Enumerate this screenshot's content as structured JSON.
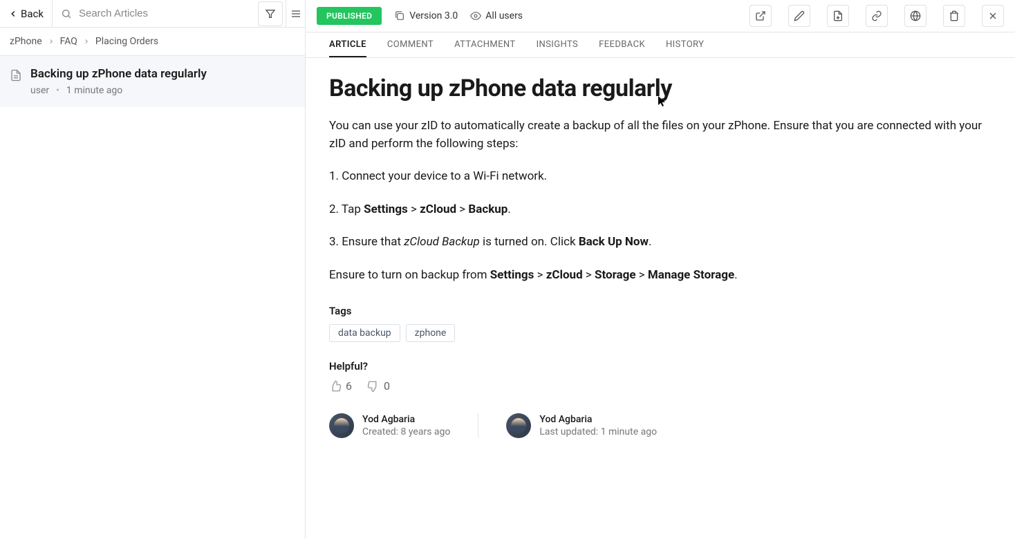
{
  "sidebar": {
    "back": "Back",
    "search_placeholder": "Search Articles"
  },
  "breadcrumb": [
    "zPhone",
    "FAQ",
    "Placing Orders"
  ],
  "list_item": {
    "title": "Backing up zPhone data regularly",
    "author": "user",
    "time": "1 minute ago"
  },
  "header": {
    "status": "PUBLISHED",
    "version": "Version 3.0",
    "visibility": "All users"
  },
  "tabs": [
    "ARTICLE",
    "COMMENT",
    "ATTACHMENT",
    "INSIGHTS",
    "FEEDBACK",
    "HISTORY"
  ],
  "article": {
    "title": "Backing up zPhone data regularly",
    "intro": "You can use your zID to automatically create a backup of all the files on your zPhone. Ensure that you are connected with your zID and perform the following steps:",
    "step1": "1. Connect your device to a Wi-Fi network.",
    "step2_pre": "2. Tap ",
    "step2_b1": "Settings",
    "step2_gt1": " > ",
    "step2_b2": "zCloud",
    "step2_gt2": " > ",
    "step2_b3": "Backup",
    "step2_end": ".",
    "step3_pre": "3. Ensure that ",
    "step3_em": "zCloud Backup",
    "step3_mid": " is turned on. Click ",
    "step3_b": "Back Up Now",
    "step3_end": ".",
    "outro_pre": "Ensure to turn on backup from ",
    "outro_b1": "Settings",
    "outro_gt1": " > ",
    "outro_b2": "zCloud",
    "outro_gt2": " > ",
    "outro_b3": "Storage",
    "outro_gt3": " > ",
    "outro_b4": "Manage Storage",
    "outro_end": "."
  },
  "tags_label": "Tags",
  "tags": [
    "data backup",
    "zphone"
  ],
  "helpful_label": "Helpful?",
  "votes": {
    "up": "6",
    "down": "0"
  },
  "authors": {
    "creator_name": "Yod Agbaria",
    "created": "Created: 8 years ago",
    "updater_name": "Yod Agbaria",
    "updated": "Last updated: 1 minute ago"
  }
}
